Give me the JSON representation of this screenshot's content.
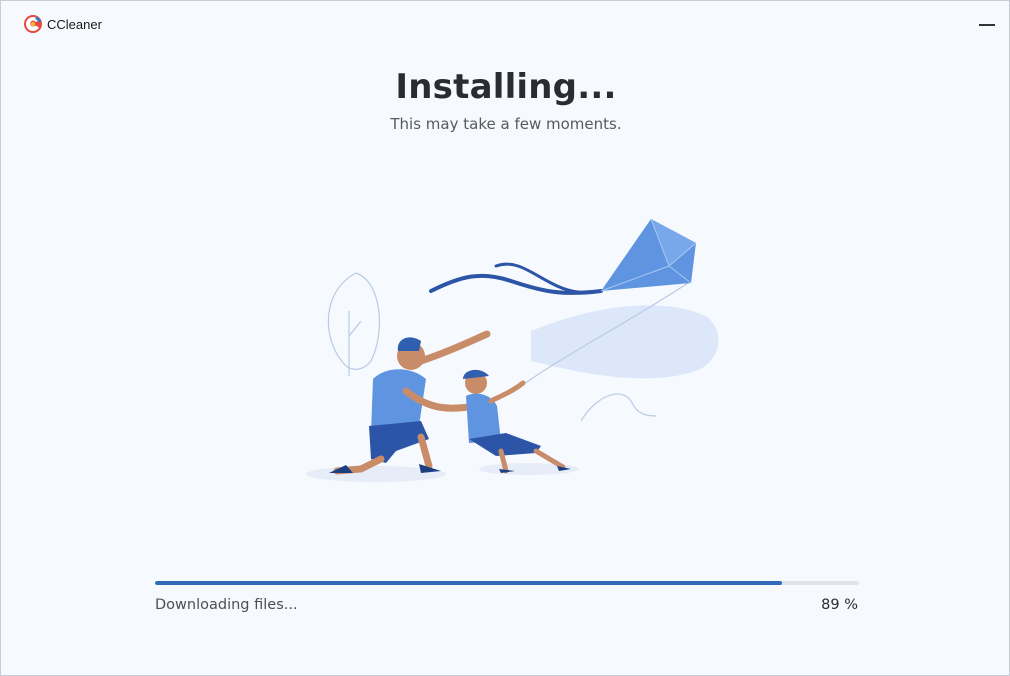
{
  "app": {
    "name": "CCleaner",
    "logo_icon": "ccleaner-logo-icon",
    "minimize_icon": "minimize-icon"
  },
  "main": {
    "title": "Installing...",
    "subtitle": "This may take a few moments."
  },
  "illustration": {
    "icon": "kite-flying-illustration"
  },
  "progress": {
    "status": "Downloading files...",
    "percent_label": "89 %",
    "value": 0.89
  },
  "colors": {
    "accent": "#2f6bb8",
    "track": "#dfe3ea",
    "background": "#f6f9fe",
    "text_dark": "#2a2b33",
    "text_muted": "#555a63"
  }
}
